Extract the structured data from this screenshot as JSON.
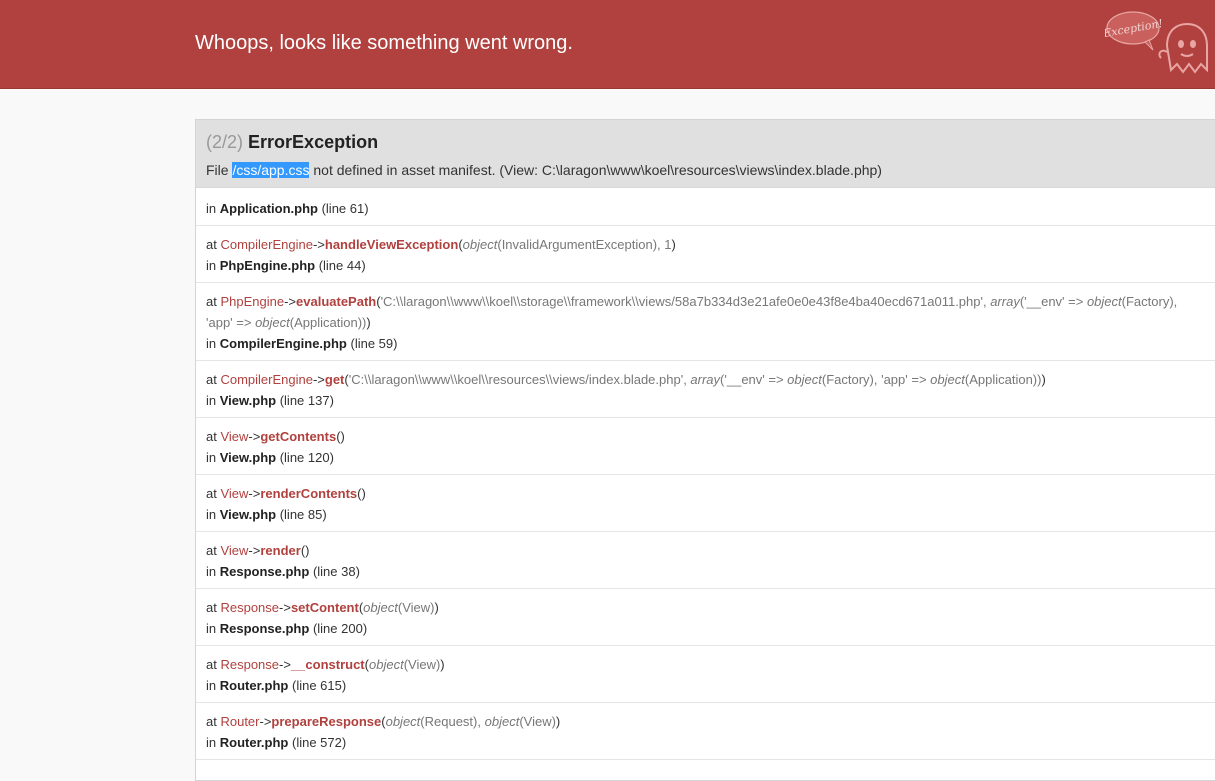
{
  "header": {
    "title": "Whoops, looks like something went wrong.",
    "logo_text": "Exception!"
  },
  "exception": {
    "count": "(2/2)",
    "type": "ErrorException",
    "msg_prefix": "File",
    "msg_highlight": "/css/app.css",
    "msg_suffix": "not defined in asset manifest. (View: C:\\laragon\\www\\koel\\resources\\views\\index.blade.php)"
  },
  "trace": [
    {
      "in": "in",
      "file": "Application.php",
      "line": "(line 61)"
    },
    {
      "at": "at",
      "cls": "CompilerEngine",
      "arrow": "->",
      "fn": "handleViewException",
      "open": "(",
      "args": "object(InvalidArgumentException), 1",
      "close": ")",
      "in": "in",
      "file": "PhpEngine.php",
      "line": "(line 44)"
    },
    {
      "at": "at",
      "cls": "PhpEngine",
      "arrow": "->",
      "fn": "evaluatePath",
      "open": "(",
      "args": "'C:\\\\laragon\\\\www\\\\koel\\\\storage\\\\framework\\\\views/58a7b334d3e21afe0e0e43f8e4ba40ecd671a011.php', array('__env' => object(Factory), 'app' => object(Application))",
      "close": ")",
      "in": "in",
      "file": "CompilerEngine.php",
      "line": "(line 59)"
    },
    {
      "at": "at",
      "cls": "CompilerEngine",
      "arrow": "->",
      "fn": "get",
      "open": "(",
      "args": "'C:\\\\laragon\\\\www\\\\koel\\\\resources\\\\views/index.blade.php', array('__env' => object(Factory), 'app' => object(Application))",
      "close": ")",
      "in": "in",
      "file": "View.php",
      "line": "(line 137)"
    },
    {
      "at": "at",
      "cls": "View",
      "arrow": "->",
      "fn": "getContents",
      "open": "(",
      "args": "",
      "close": ")",
      "in": "in",
      "file": "View.php",
      "line": "(line 120)"
    },
    {
      "at": "at",
      "cls": "View",
      "arrow": "->",
      "fn": "renderContents",
      "open": "(",
      "args": "",
      "close": ")",
      "in": "in",
      "file": "View.php",
      "line": "(line 85)"
    },
    {
      "at": "at",
      "cls": "View",
      "arrow": "->",
      "fn": "render",
      "open": "(",
      "args": "",
      "close": ")",
      "in": "in",
      "file": "Response.php",
      "line": "(line 38)"
    },
    {
      "at": "at",
      "cls": "Response",
      "arrow": "->",
      "fn": "setContent",
      "open": "(",
      "args": "object(View)",
      "close": ")",
      "in": "in",
      "file": "Response.php",
      "line": "(line 200)"
    },
    {
      "at": "at",
      "cls": "Response",
      "arrow": "->",
      "fn": "__construct",
      "open": "(",
      "args": "object(View)",
      "close": ")",
      "in": "in",
      "file": "Router.php",
      "line": "(line 615)"
    },
    {
      "at": "at",
      "cls": "Router",
      "arrow": "->",
      "fn": "prepareResponse",
      "open": "(",
      "args": "object(Request), object(View)",
      "close": ")",
      "in": "in",
      "file": "Router.php",
      "line": "(line 572)"
    }
  ],
  "colors": {
    "header_bg": "#b0413e",
    "accent": "#b0413e",
    "exception_header_bg": "#e0e0e0",
    "selection": "#3399ff"
  }
}
